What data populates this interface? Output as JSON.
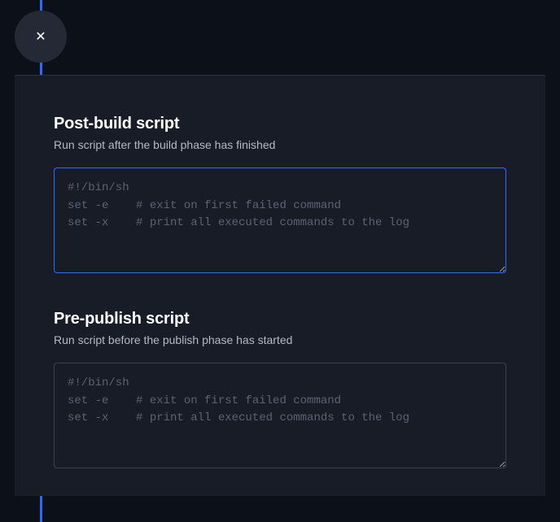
{
  "close": {
    "glyph": "✕"
  },
  "sections": {
    "postBuild": {
      "title": "Post-build script",
      "desc": "Run script after the build phase has finished",
      "placeholder": "#!/bin/sh\nset -e    # exit on first failed command\nset -x    # print all executed commands to the log",
      "value": ""
    },
    "prePublish": {
      "title": "Pre-publish script",
      "desc": "Run script before the publish phase has started",
      "placeholder": "#!/bin/sh\nset -e    # exit on first failed command\nset -x    # print all executed commands to the log",
      "value": ""
    }
  }
}
